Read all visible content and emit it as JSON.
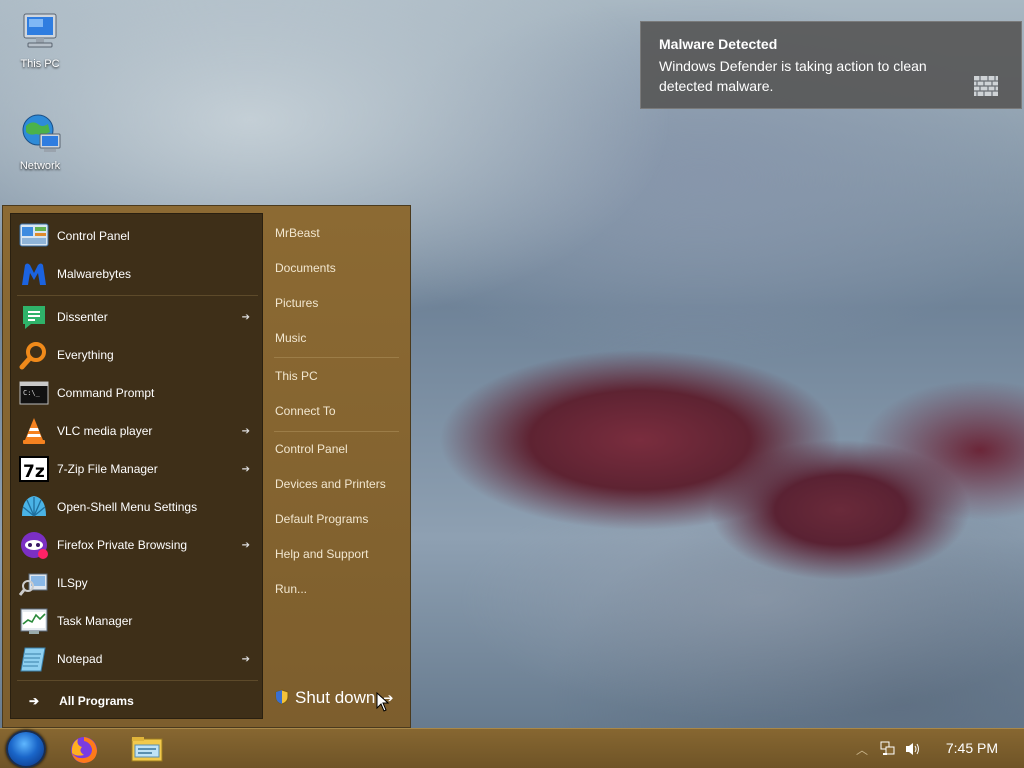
{
  "desktop": {
    "icons": [
      {
        "label": "This PC",
        "icon": "computer-icon"
      },
      {
        "label": "Network",
        "icon": "network-icon"
      }
    ]
  },
  "toast": {
    "title": "Malware Detected",
    "body": "Windows Defender is taking action to clean detected malware.",
    "icon": "firewall-icon"
  },
  "start_menu": {
    "pinned": [
      {
        "label": "Control Panel",
        "icon": "control-panel-icon",
        "submenu": false
      },
      {
        "label": "Malwarebytes",
        "icon": "malwarebytes-icon",
        "submenu": false
      }
    ],
    "recent": [
      {
        "label": "Dissenter",
        "icon": "dissenter-icon",
        "submenu": true
      },
      {
        "label": "Everything",
        "icon": "search-icon",
        "submenu": false
      },
      {
        "label": "Command Prompt",
        "icon": "cmd-icon",
        "submenu": false
      },
      {
        "label": "VLC media player",
        "icon": "vlc-icon",
        "submenu": true
      },
      {
        "label": "7-Zip File Manager",
        "icon": "7zip-icon",
        "submenu": true
      },
      {
        "label": "Open-Shell Menu Settings",
        "icon": "shell-icon",
        "submenu": false
      },
      {
        "label": "Firefox Private Browsing",
        "icon": "firefox-private-icon",
        "submenu": true
      },
      {
        "label": "ILSpy",
        "icon": "ilspy-icon",
        "submenu": false
      },
      {
        "label": "Task Manager",
        "icon": "task-manager-icon",
        "submenu": false
      },
      {
        "label": "Notepad",
        "icon": "notepad-icon",
        "submenu": true
      }
    ],
    "all_programs": "All Programs",
    "right": [
      {
        "label": "MrBeast"
      },
      {
        "label": "Documents"
      },
      {
        "label": "Pictures"
      },
      {
        "label": "Music"
      },
      {
        "label": "This PC"
      },
      {
        "label": "Connect To"
      },
      {
        "label": "Control Panel"
      },
      {
        "label": "Devices and Printers"
      },
      {
        "label": "Default Programs"
      },
      {
        "label": "Help and Support"
      },
      {
        "label": "Run..."
      }
    ],
    "shutdown": "Shut down"
  },
  "taskbar": {
    "pinned": [
      {
        "name": "Firefox",
        "icon": "firefox-icon"
      },
      {
        "name": "File Explorer",
        "icon": "file-explorer-icon"
      }
    ],
    "clock": "7:45 PM"
  },
  "colors": {
    "menu_frame": "#8c6a33",
    "menu_left_pane": "#3e2f18",
    "taskbar": "#876731",
    "toast_bg": "#585858"
  }
}
